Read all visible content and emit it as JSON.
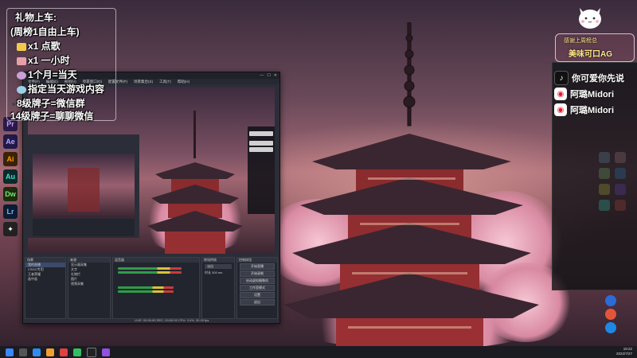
{
  "gift_panel": {
    "title": "礼物上车:",
    "subtitle": "(周榜1自由上车)",
    "items": [
      {
        "icon": "gold-bar-icon",
        "text": "x1 点歌"
      },
      {
        "icon": "cake-icon",
        "text": "x1 一小时"
      },
      {
        "icon": "character-icon",
        "text": "1个月=当天"
      },
      {
        "icon": "character-icon-2",
        "text": "指定当天游戏内容"
      },
      {
        "icon": "dot-icon",
        "text": "8级牌子=微信群"
      },
      {
        "icon": "",
        "text": "14级牌子=聊聊微信"
      }
    ]
  },
  "badge": {
    "line1": "感谢上周榜总",
    "line2": "美味可口AG"
  },
  "social_links": [
    {
      "platform": "douyin",
      "icon": "tiktok-icon",
      "label": "你可爱你先说",
      "color": "#111111"
    },
    {
      "platform": "weibo",
      "icon": "weibo-icon",
      "label": "阿璐Midori",
      "color": "#e6162d"
    },
    {
      "platform": "weibo",
      "icon": "weibo-icon",
      "label": "阿璐Midori",
      "color": "#e6162d"
    }
  ],
  "obs": {
    "menu": [
      "文件(F)",
      "编辑(E)",
      "视图(V)",
      "停靠窗口(D)",
      "配置文件(P)",
      "场景集合(S)",
      "工具(T)",
      "帮助(H)"
    ],
    "docks": {
      "scenes": "场景",
      "sources": "来源",
      "mixer": "混音器",
      "transitions": "转场特效",
      "controls": "控制按钮"
    },
    "scene_items": [
      "我的直播",
      "CSGO专用",
      "王者荣耀",
      "画中画"
    ],
    "source_items": [
      "显示器采集",
      "文字",
      "礼物栏",
      "图片",
      "视频采集"
    ],
    "control_buttons": [
      "开始直播",
      "开始录制",
      "启动虚拟摄像机",
      "工作室模式",
      "设置",
      "退出"
    ],
    "transition_value": "淡出",
    "duration_label": "时长",
    "duration_value": "300 ms",
    "status": "LIVE: 00:00:00  REC: 00:00:00  CPU: 3.4%, 30.00 fps"
  },
  "clock": {
    "time": "19:22",
    "date": "2022/7/27"
  },
  "colors": {
    "obs_bg": "#2b2e38",
    "accent_pink": "#f6c7d4",
    "taskbar": "#1b1b22"
  }
}
